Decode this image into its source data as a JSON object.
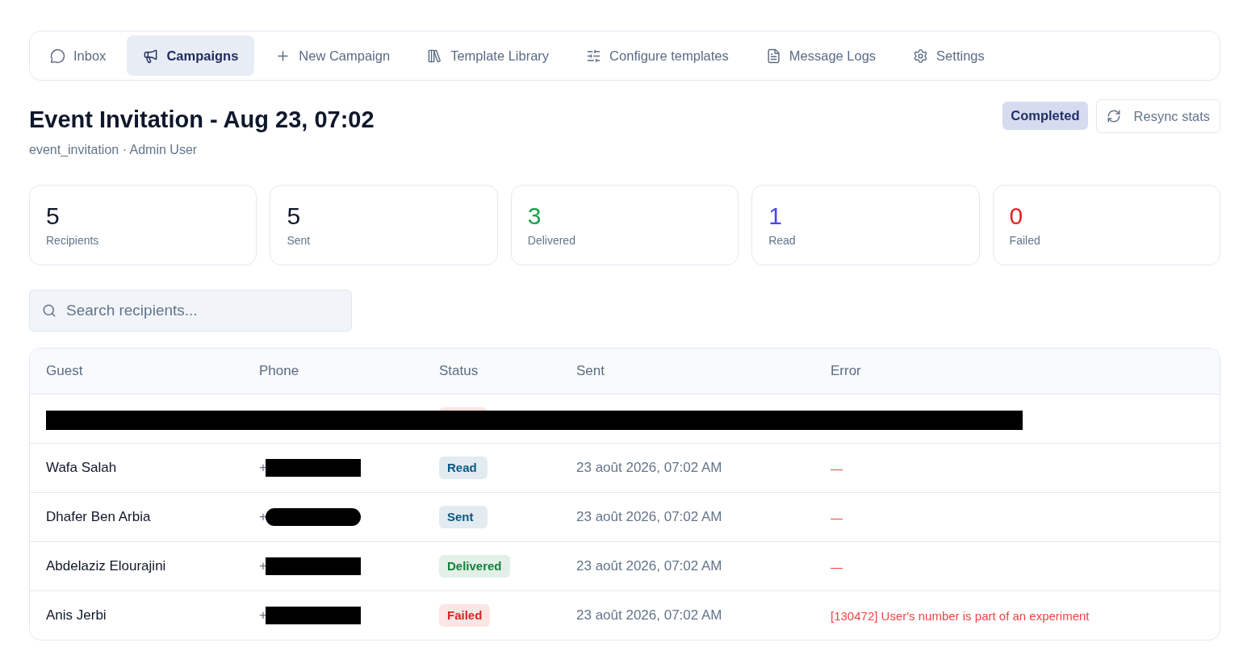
{
  "nav": [
    {
      "label": "Inbox",
      "selected": false
    },
    {
      "label": "Campaigns",
      "selected": true
    },
    {
      "label": "New Campaign",
      "selected": false
    },
    {
      "label": "Template Library",
      "selected": false
    },
    {
      "label": "Configure templates",
      "selected": false
    },
    {
      "label": "Message Logs",
      "selected": false
    },
    {
      "label": "Settings",
      "selected": false
    }
  ],
  "header": {
    "title": "Event Invitation - Aug 23, 07:02",
    "subtitle": "event_invitation · Admin User",
    "status": "Completed",
    "resync": "Resync stats"
  },
  "stats": [
    {
      "value": "5",
      "label": "Recipients",
      "color": "#0f172a"
    },
    {
      "value": "5",
      "label": "Sent",
      "color": "#0f172a"
    },
    {
      "value": "3",
      "label": "Delivered",
      "color": "#16a34a"
    },
    {
      "value": "1",
      "label": "Read",
      "color": "#4f46e5"
    },
    {
      "value": "0",
      "label": "Failed",
      "color": "#dc2626"
    }
  ],
  "search": {
    "placeholder": "Search recipients..."
  },
  "table": {
    "columns": [
      "Guest",
      "Phone",
      "Status",
      "Sent",
      "Error"
    ],
    "rows": [
      {
        "kind": "redacted"
      },
      {
        "kind": "recipient",
        "guest": "Wafa Salah",
        "phone": "+",
        "status": "Read",
        "color": "#075985",
        "sent": "23 août 2026, 07:02 AM",
        "error": "—"
      },
      {
        "kind": "recipient",
        "guest": "Dhafer Ben Arbia",
        "phone": "+",
        "status": "Sent",
        "color": "#075985",
        "sent": "23 août 2026, 07:02 AM",
        "error": "—"
      },
      {
        "kind": "recipient",
        "guest": "Abdelaziz Elourajini",
        "phone": "+",
        "status": "Delivered",
        "color": "#15803d",
        "sent": "23 août 2026, 07:02 AM",
        "error": "—"
      },
      {
        "kind": "recipient",
        "guest": "Anis Jerbi",
        "phone": "+",
        "status": "Failed",
        "color": "#dc2626",
        "sent": "23 août 2026, 07:02 AM",
        "error": "[130472] User's number is part of an experiment"
      }
    ]
  }
}
